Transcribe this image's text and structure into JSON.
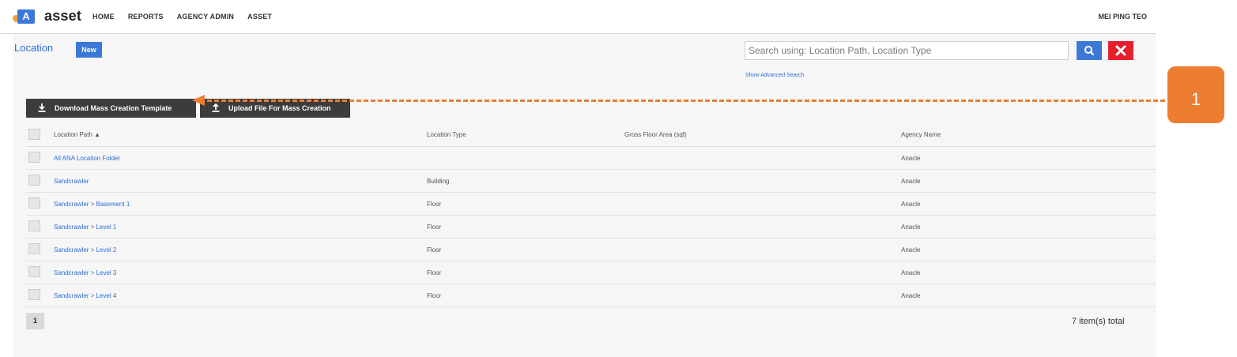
{
  "app": {
    "logo_letter": "A",
    "logo_text": "asset"
  },
  "nav": {
    "items": [
      "HOME",
      "REPORTS",
      "AGENCY ADMIN",
      "ASSET"
    ],
    "user": "MEI PING TEO"
  },
  "page": {
    "title": "Location",
    "new_label": "New"
  },
  "search": {
    "placeholder": "Search using: Location Path, Location Type",
    "advanced_link": "Show Advanced Search",
    "search_icon": "search-icon",
    "clear_icon": "close-icon"
  },
  "actions": {
    "download_label": "Download Mass Creation Template",
    "upload_label": "Upload File For Mass Creation"
  },
  "table": {
    "columns": [
      "Location Path",
      "Location Type",
      "Gross Floor Area (sqf)",
      "Agency Name"
    ],
    "sort_indicator": "▲",
    "rows": [
      {
        "path": "All ANA Location Folder",
        "type": "",
        "area": "",
        "agency": "Anacle"
      },
      {
        "path": "Sandcrawler",
        "type": "Building",
        "area": "",
        "agency": "Anacle"
      },
      {
        "path": "Sandcrawler > Basement 1",
        "type": "Floor",
        "area": "",
        "agency": "Anacle"
      },
      {
        "path": "Sandcrawler > Level 1",
        "type": "Floor",
        "area": "",
        "agency": "Anacle"
      },
      {
        "path": "Sandcrawler > Level 2",
        "type": "Floor",
        "area": "",
        "agency": "Anacle"
      },
      {
        "path": "Sandcrawler > Level 3",
        "type": "Floor",
        "area": "",
        "agency": "Anacle"
      },
      {
        "path": "Sandcrawler > Level 4",
        "type": "Floor",
        "area": "",
        "agency": "Anacle"
      }
    ]
  },
  "pagination": {
    "current_page": "1",
    "total": "7 item(s) total"
  },
  "callout": {
    "label": "1"
  },
  "colors": {
    "accent": "#3b78d8",
    "danger": "#e4202e",
    "callout": "#ed7d31",
    "link": "#2c6fd6"
  }
}
